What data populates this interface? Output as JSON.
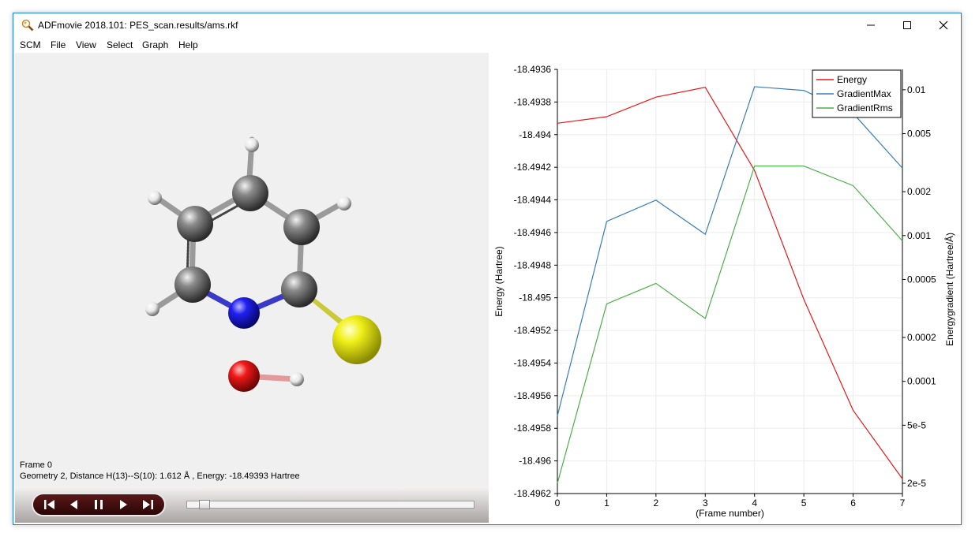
{
  "window": {
    "title": "ADFmovie 2018.101: PES_scan.results/ams.rkf",
    "controls": [
      "minimize-icon",
      "maximize-icon",
      "close-icon"
    ]
  },
  "menu": {
    "scm": "SCM",
    "file": "File",
    "view": "View",
    "select": "Select",
    "graph": "Graph",
    "help": "Help"
  },
  "viewer": {
    "frame_label": "Frame 0",
    "geometry_info": "Geometry 2, Distance H(13)--S(10): 1.612 Å , Energy: -18.49393 Hartree",
    "atoms": [
      "C",
      "C",
      "C",
      "C",
      "C",
      "N",
      "O",
      "S",
      "H",
      "H",
      "H",
      "H",
      "H"
    ],
    "atom_colors": {
      "C": "#7d7d7d",
      "N": "#1a1aee",
      "O": "#ee1a1a",
      "S": "#e8e816",
      "H": "#ffffff"
    }
  },
  "player": {
    "buttons": [
      "first-frame-icon",
      "previous-frame-icon",
      "pause-icon",
      "next-frame-icon",
      "last-frame-icon"
    ],
    "slider_fraction": 0.0
  },
  "chart_data": {
    "type": "line",
    "xlabel": "(Frame number)",
    "ylabel": "Energy (Hartree)",
    "y2label": "Energygradient (Hartree/Å)",
    "x": [
      0,
      1,
      2,
      3,
      4,
      5,
      6,
      7
    ],
    "xlim": [
      0,
      7
    ],
    "ylim": [
      -18.4962,
      -18.4936
    ],
    "y2lim": [
      1.7e-05,
      0.0138
    ],
    "y2scale": "log",
    "x_ticks": [
      "0",
      "1",
      "2",
      "3",
      "4",
      "5",
      "6",
      "7"
    ],
    "y_ticks": [
      "-18.4936",
      "-18.4938",
      "-18.494",
      "-18.4942",
      "-18.4944",
      "-18.4946",
      "-18.4948",
      "-18.495",
      "-18.4952",
      "-18.4954",
      "-18.4956",
      "-18.4958",
      "-18.496",
      "-18.4962"
    ],
    "y_tick_values": [
      -18.4936,
      -18.4938,
      -18.494,
      -18.4942,
      -18.4944,
      -18.4946,
      -18.4948,
      -18.495,
      -18.4952,
      -18.4954,
      -18.4956,
      -18.4958,
      -18.496,
      -18.4962
    ],
    "y2_ticks": [
      "0.01",
      "0.005",
      "0.002",
      "0.001",
      "0.0005",
      "0.0002",
      "0.0001",
      "5e-5",
      "2e-5"
    ],
    "y2_tick_values": [
      0.01,
      0.005,
      0.002,
      0.001,
      0.0005,
      0.0002,
      0.0001,
      5e-05,
      2e-05
    ],
    "legend_position": "top-right",
    "grid": true,
    "series": [
      {
        "name": "Energy",
        "axis": "left",
        "color": "#e41a1c",
        "values": [
          -18.49393,
          -18.49389,
          -18.49377,
          -18.49371,
          -18.49422,
          -18.49501,
          -18.49569,
          -18.49611
        ]
      },
      {
        "name": "GradientMax",
        "axis": "right",
        "color": "#377eb8",
        "values": [
          5.8e-05,
          0.00125,
          0.00175,
          0.00102,
          0.0105,
          0.0099,
          0.0069,
          0.0029
        ]
      },
      {
        "name": "GradientRms",
        "axis": "right",
        "color": "#4daf4a",
        "values": [
          2e-05,
          0.00034,
          0.00047,
          0.00027,
          0.003,
          0.003,
          0.0022,
          0.00092
        ]
      }
    ]
  }
}
